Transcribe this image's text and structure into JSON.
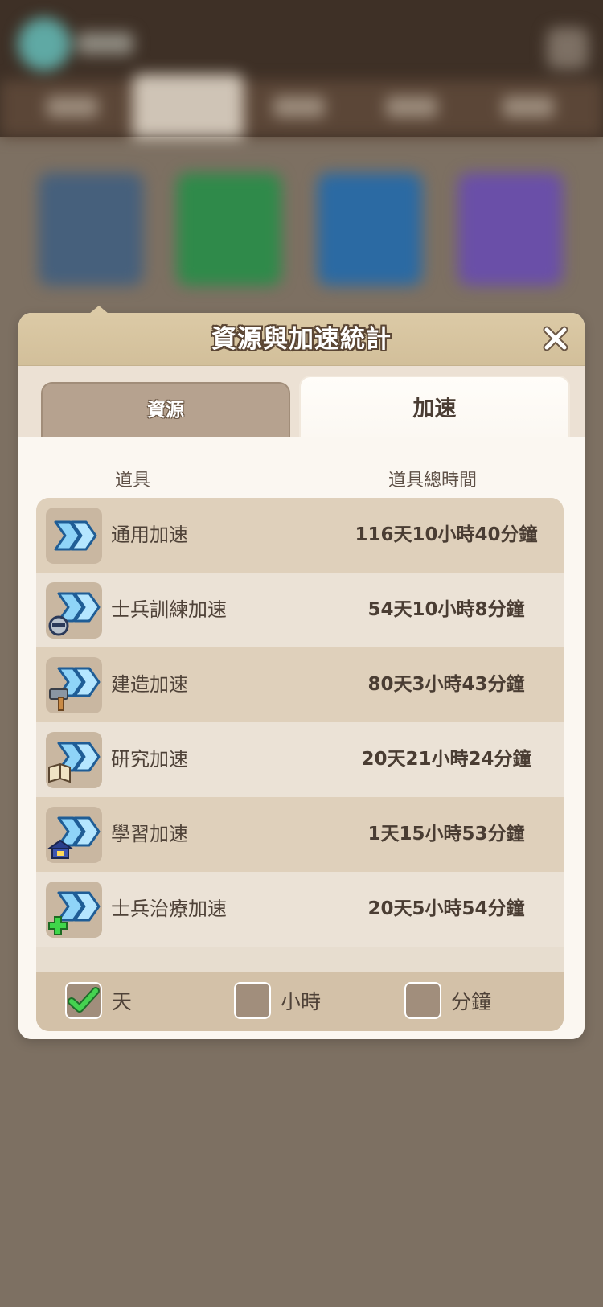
{
  "dialog": {
    "title": "資源與加速統計",
    "close_icon": "close-icon"
  },
  "tabs": [
    {
      "label": "資源",
      "active": false
    },
    {
      "label": "加速",
      "active": true
    }
  ],
  "table": {
    "col_item": "道具",
    "col_total": "道具總時間",
    "rows": [
      {
        "name": "通用加速",
        "total": "116天10小時40分鐘",
        "icon": "speedup-general-icon"
      },
      {
        "name": "士兵訓練加速",
        "total": "54天10小時8分鐘",
        "icon": "speedup-training-icon"
      },
      {
        "name": "建造加速",
        "total": "80天3小時43分鐘",
        "icon": "speedup-building-icon"
      },
      {
        "name": "研究加速",
        "total": "20天21小時24分鐘",
        "icon": "speedup-research-icon"
      },
      {
        "name": "學習加速",
        "total": "1天15小時53分鐘",
        "icon": "speedup-learning-icon"
      },
      {
        "name": "士兵治療加速",
        "total": "20天5小時54分鐘",
        "icon": "speedup-healing-icon"
      }
    ]
  },
  "filters": [
    {
      "label": "天",
      "checked": true
    },
    {
      "label": "小時",
      "checked": false
    },
    {
      "label": "分鐘",
      "checked": false
    }
  ],
  "colors": {
    "header": "#d8c6a2",
    "check": "#3fbf4a",
    "row_dark": "#dfd0bb",
    "row_light": "#ebe2d6"
  }
}
